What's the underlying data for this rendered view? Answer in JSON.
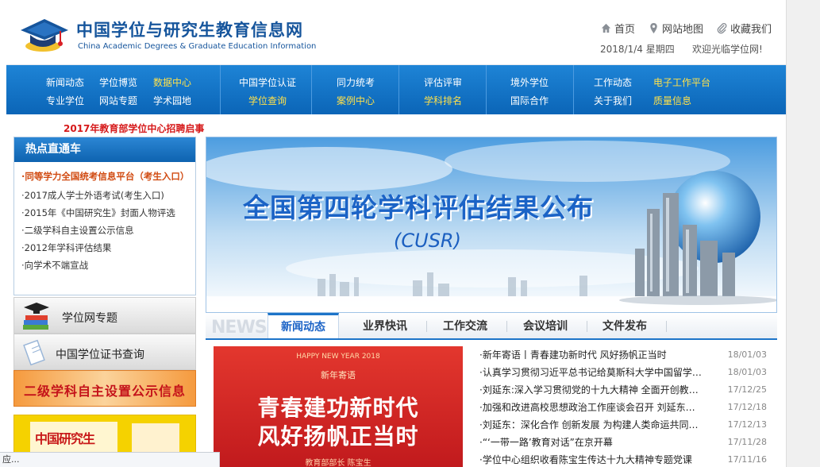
{
  "header": {
    "title": "中国学位与研究生教育信息网",
    "title_en": "China Academic Degrees & Graduate Education Information",
    "links": {
      "home": "首页",
      "sitemap": "网站地图",
      "favorite": "收藏我们"
    },
    "date": "2018/1/4 星期四",
    "welcome": "欢迎光临学位网!"
  },
  "nav": {
    "g1": [
      "新闻动态",
      "学位博览",
      "数据中心",
      "专业学位",
      "网站专题",
      "学术园地"
    ],
    "g2": [
      "中国学位认证",
      "学位查询"
    ],
    "g3": [
      "同力统考",
      "案例中心"
    ],
    "g4": [
      "评估评审",
      "学科排名"
    ],
    "g5": [
      "境外学位",
      "国际合作"
    ],
    "g6": [
      "工作动态",
      "电子工作平台",
      "关于我们",
      "质量信息"
    ]
  },
  "notice": "2017年教育部学位中心招聘启事",
  "hot": {
    "title": "热点直通车",
    "items": [
      "·同等学力全国统考信息平台（考生入口）",
      "·2017成人学士外语考试(考生入口)",
      "·2015年《中国研究生》封面人物评选",
      "·二级学科自主设置公示信息",
      "·2012年学科评估结果",
      "·向学术不端宣战"
    ]
  },
  "side": {
    "topic": "学位网专题",
    "certificate": "中国学位证书查询",
    "orange": "二级学科自主设置公示信息",
    "magazine": "中国研究生"
  },
  "hero": {
    "title": "全国第四轮学科评估结果公布",
    "subtitle": "(CUSR)"
  },
  "tabs": {
    "watermark": "NEWS",
    "items": [
      "新闻动态",
      "业界快讯",
      "工作交流",
      "会议培训",
      "文件发布"
    ]
  },
  "news_image": {
    "year": "HAPPY NEW YEAR 2018",
    "label": "新年寄语",
    "line1": "青春建功新时代",
    "line2": "风好扬帆正当时",
    "footer": "教育部部长 陈宝生"
  },
  "news": [
    {
      "title": "·新年寄语丨青春建功新时代 风好扬帆正当时",
      "date": "18/01/03"
    },
    {
      "title": "·认真学习贯彻习近平总书记给莫斯科大学中国留学生回信精神",
      "date": "18/01/03"
    },
    {
      "title": "·刘延东:深入学习贯彻党的十九大精神 全面开创教育事业新局面",
      "date": "17/12/25"
    },
    {
      "title": "·加强和改进高校思想政治工作座谈会召开 刘延东出席并讲话",
      "date": "17/12/18"
    },
    {
      "title": "·刘延东：深化合作 创新发展 为构建人类命运共同体作贡献",
      "date": "17/12/13"
    },
    {
      "title": "·“‘一带一路’教育对话”在京开幕",
      "date": "17/11/28"
    },
    {
      "title": "·学位中心组织收看陈宝生传达十九大精神专题党课",
      "date": "17/11/16"
    }
  ],
  "status": "应..."
}
